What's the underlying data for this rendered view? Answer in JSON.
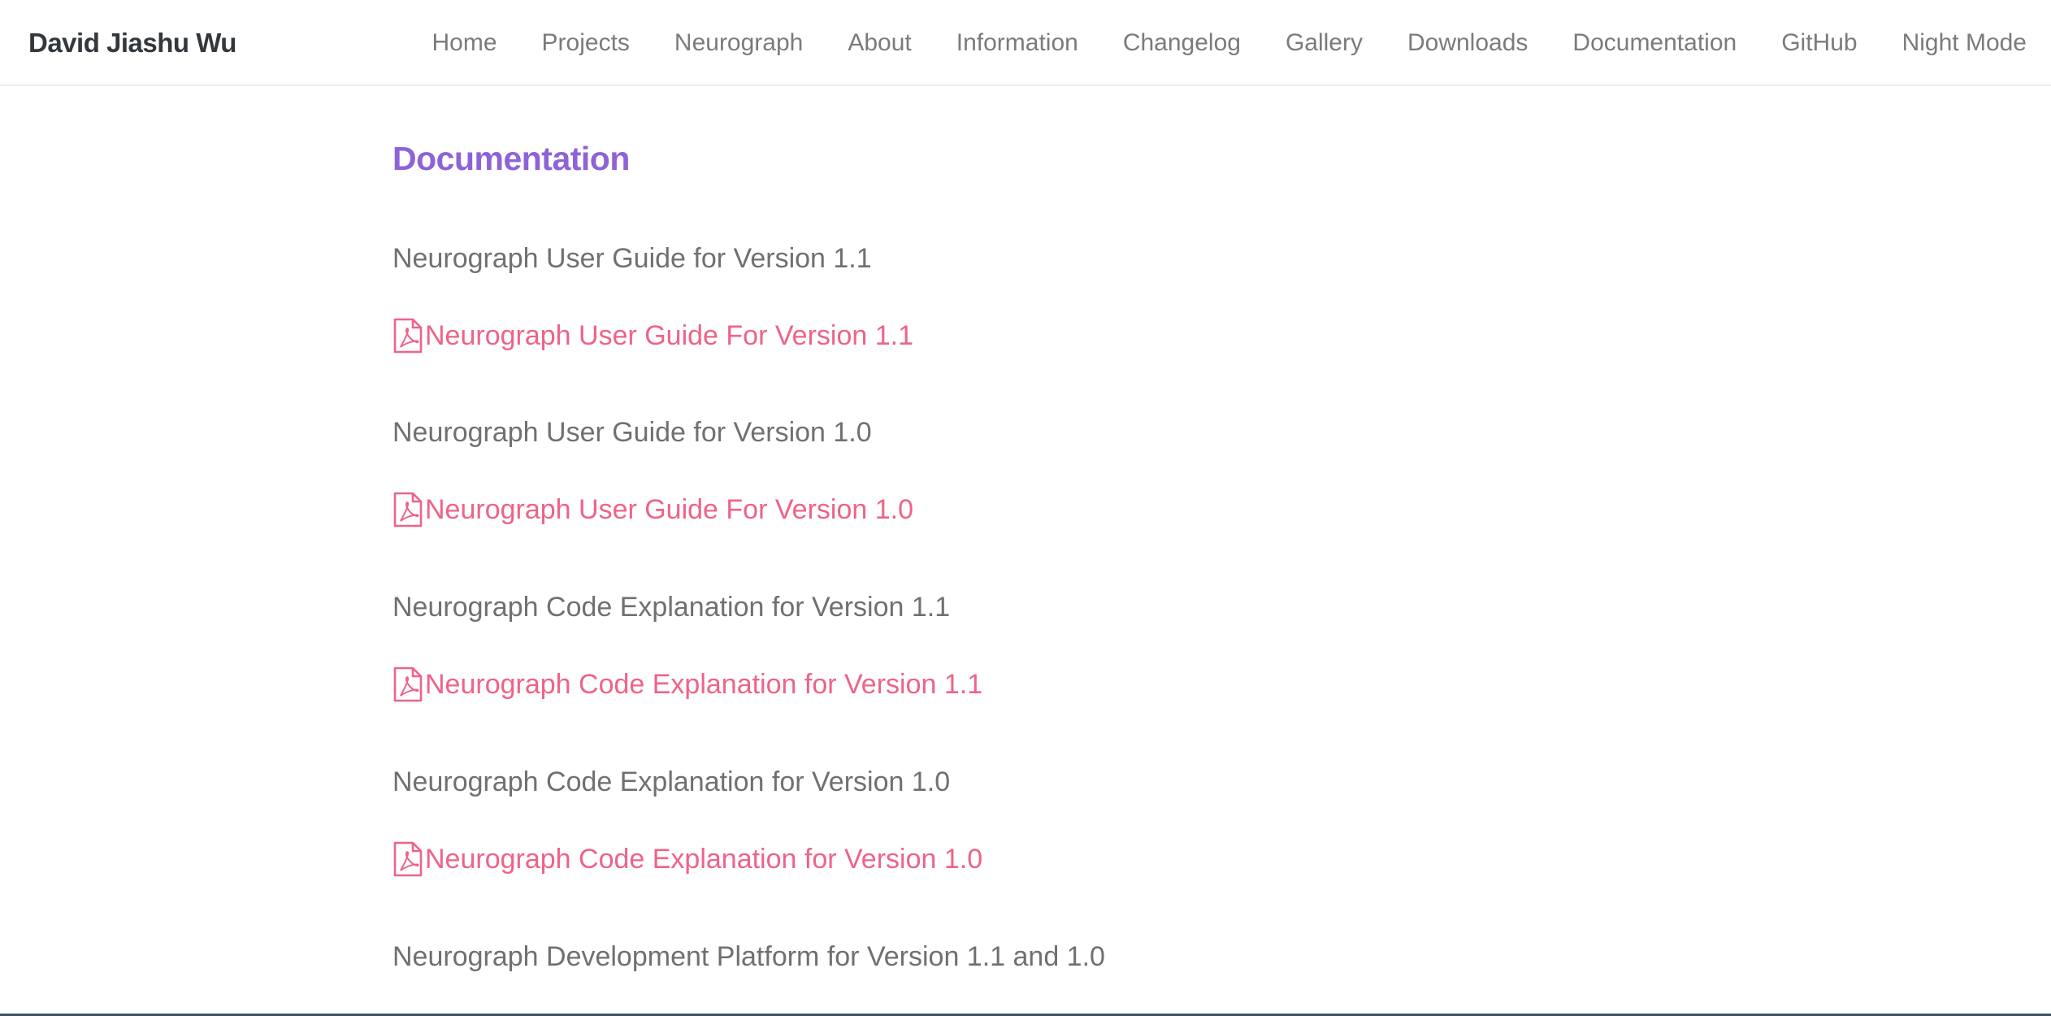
{
  "brand": "David Jiashu Wu",
  "nav": {
    "items": [
      {
        "label": "Home"
      },
      {
        "label": "Projects"
      },
      {
        "label": "Neurograph"
      },
      {
        "label": "About"
      },
      {
        "label": "Information"
      },
      {
        "label": "Changelog"
      },
      {
        "label": "Gallery"
      },
      {
        "label": "Downloads"
      },
      {
        "label": "Documentation"
      },
      {
        "label": "GitHub"
      },
      {
        "label": "Night Mode"
      }
    ]
  },
  "page": {
    "title": "Documentation",
    "entries": [
      {
        "heading": "Neurograph User Guide for Version 1.1",
        "link": "Neurograph User Guide For Version 1.1"
      },
      {
        "heading": "Neurograph User Guide for Version 1.0",
        "link": "Neurograph User Guide For Version 1.0"
      },
      {
        "heading": "Neurograph Code Explanation for Version 1.1",
        "link": "Neurograph Code Explanation for Version 1.1"
      },
      {
        "heading": "Neurograph Code Explanation for Version 1.0",
        "link": "Neurograph Code Explanation for Version 1.0"
      },
      {
        "heading": "Neurograph Development Platform for Version 1.1 and 1.0"
      }
    ]
  },
  "icons": {
    "pdf": "file-pdf-icon"
  },
  "colors": {
    "accent_title": "#8e62d8",
    "link": "#ee6389",
    "brand": "#33383d"
  }
}
